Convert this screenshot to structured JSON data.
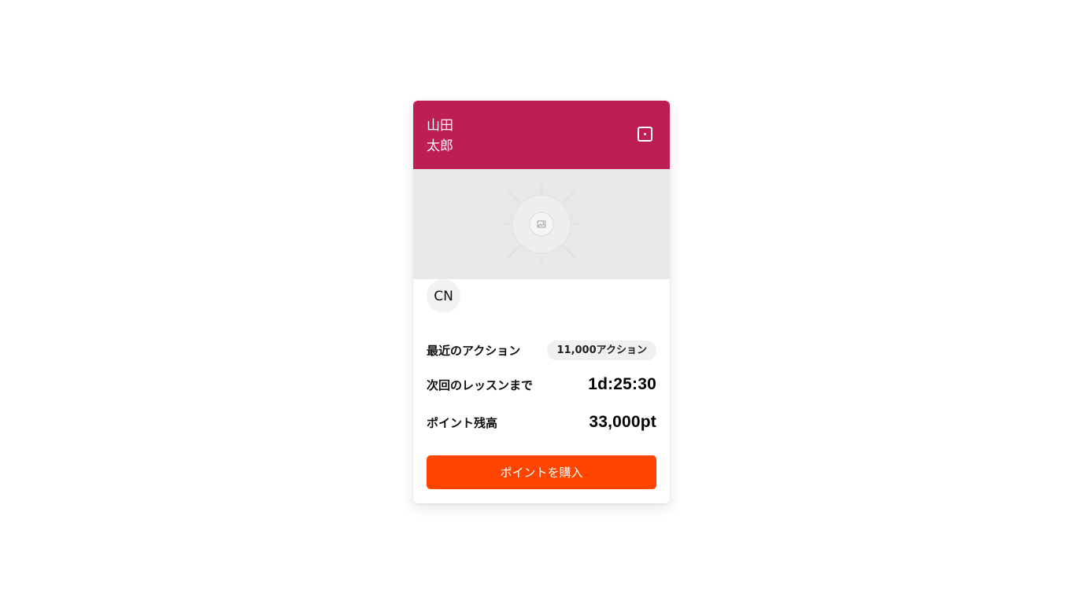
{
  "colors": {
    "brand": "#BE1E56",
    "accent": "#FF4500"
  },
  "profile": {
    "name_line1": "山田",
    "name_line2": "太郎",
    "avatar_initials": "CN"
  },
  "header": {
    "icon": "square-dot-icon"
  },
  "banner": {
    "icon": "image-placeholder-icon"
  },
  "stats": {
    "recent_actions_label": "最近のアクション",
    "recent_actions_value": "11,000アクション",
    "next_lesson_label": "次回のレッスンまで",
    "next_lesson_value": "1d:25:30",
    "points_label": "ポイント残高",
    "points_value": "33,000pt"
  },
  "actions": {
    "buy_points_label": "ポイントを購入"
  }
}
